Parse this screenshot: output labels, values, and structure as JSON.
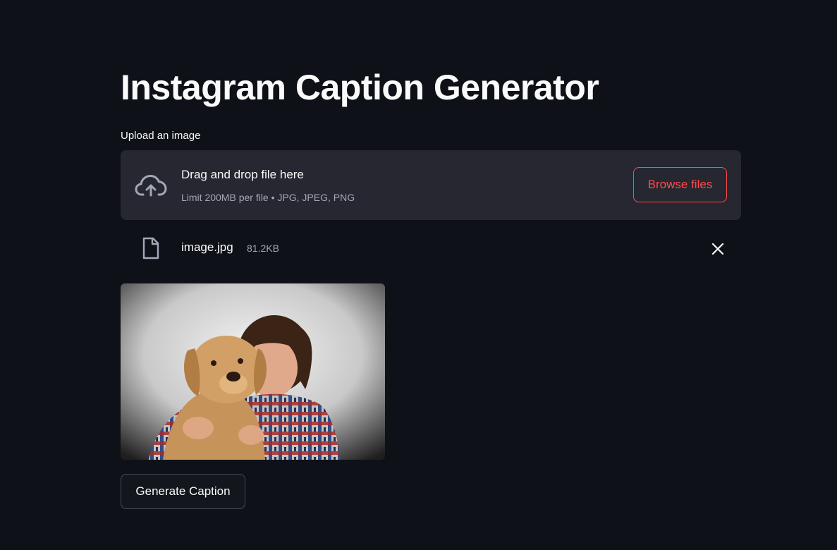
{
  "page": {
    "title": "Instagram Caption Generator"
  },
  "uploader": {
    "label": "Upload an image",
    "dropzone_title": "Drag and drop file here",
    "dropzone_subtitle": "Limit 200MB per file • JPG, JPEG, PNG",
    "browse_label": "Browse files",
    "cloud_icon": "cloud-upload-icon"
  },
  "uploaded_file": {
    "name": "image.jpg",
    "size": "81.2KB",
    "file_icon": "file-icon",
    "remove_icon": "close-icon"
  },
  "preview": {
    "image_icon": "photo-man-kissing-dog"
  },
  "actions": {
    "generate_label": "Generate Caption"
  },
  "colors": {
    "background": "#0e1117",
    "dropzone_bg": "#262730",
    "accent": "#ff4b4b",
    "text": "#fafafa",
    "muted_text": "#a3a8b8"
  }
}
